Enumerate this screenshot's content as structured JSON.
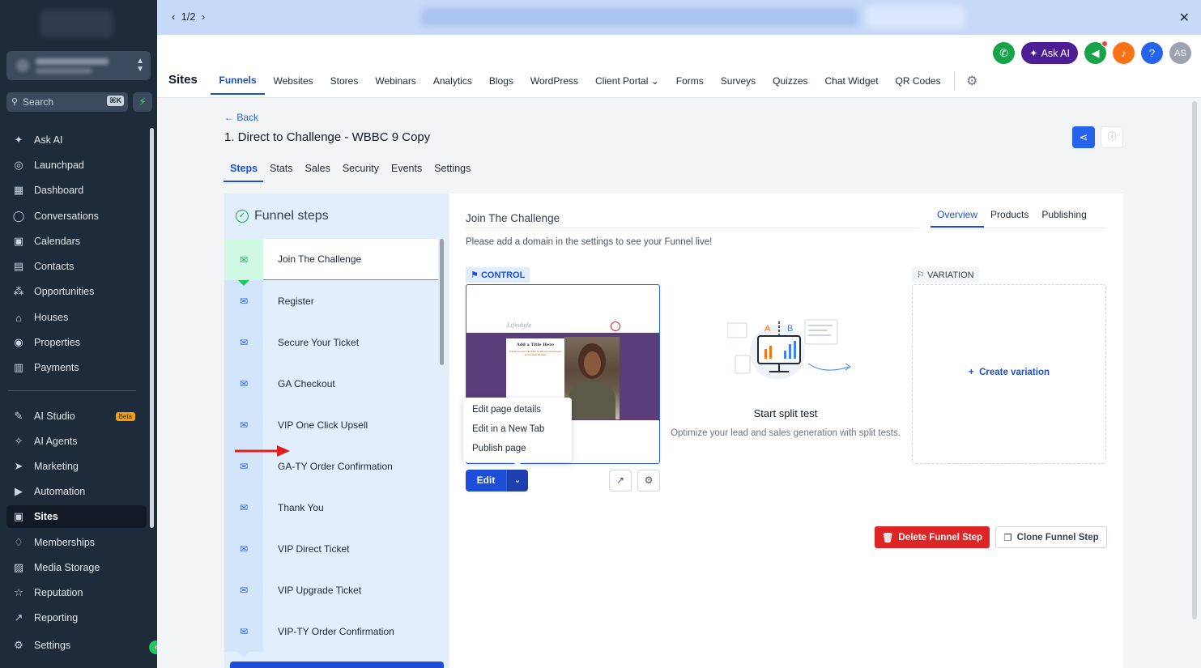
{
  "banner": {
    "pager": "1/2",
    "prev_icon": "chevron-left-icon",
    "next_icon": "chevron-right-icon",
    "close_icon": "close-icon"
  },
  "sidebar": {
    "search_placeholder": "Search",
    "search_shortcut": "⌘K",
    "items": [
      {
        "label": "Ask AI",
        "icon": "sparkle-icon"
      },
      {
        "label": "Launchpad",
        "icon": "rocket-icon"
      },
      {
        "label": "Dashboard",
        "icon": "grid-icon"
      },
      {
        "label": "Conversations",
        "icon": "chat-icon"
      },
      {
        "label": "Calendars",
        "icon": "calendar-icon"
      },
      {
        "label": "Contacts",
        "icon": "contacts-icon"
      },
      {
        "label": "Opportunities",
        "icon": "pipeline-icon"
      },
      {
        "label": "Houses",
        "icon": "house-icon"
      },
      {
        "label": "Properties",
        "icon": "search-circle-icon"
      },
      {
        "label": "Payments",
        "icon": "receipt-icon"
      },
      {
        "label": "AI Studio",
        "icon": "ai-studio-icon",
        "badge": "Beta"
      },
      {
        "label": "AI Agents",
        "icon": "sparkle-icon"
      },
      {
        "label": "Marketing",
        "icon": "send-icon"
      },
      {
        "label": "Automation",
        "icon": "play-circle-icon"
      },
      {
        "label": "Sites",
        "icon": "sites-icon"
      },
      {
        "label": "Memberships",
        "icon": "badge-icon"
      },
      {
        "label": "Media Storage",
        "icon": "image-icon"
      },
      {
        "label": "Reputation",
        "icon": "star-icon"
      },
      {
        "label": "Reporting",
        "icon": "chart-icon"
      }
    ],
    "settings_label": "Settings",
    "active_item": "Sites"
  },
  "header": {
    "ask_ai_label": "Ask AI",
    "avatar_initials": "AS",
    "help_label": "?",
    "section_title": "Sites",
    "nav": [
      "Funnels",
      "Websites",
      "Stores",
      "Webinars",
      "Analytics",
      "Blogs",
      "WordPress",
      "Client Portal",
      "Forms",
      "Surveys",
      "Quizzes",
      "Chat Widget",
      "QR Codes"
    ],
    "active_nav": "Funnels",
    "colors": {
      "phone": "#16a34a",
      "askai": "#4c1d95",
      "announce": "#16a34a",
      "bell": "#f97316",
      "help": "#2563eb",
      "avatar": "#9ca3af"
    }
  },
  "funnel": {
    "back_label": "← Back",
    "title": "1. Direct to Challenge - WBBC 9 Copy",
    "tabs": [
      "Steps",
      "Stats",
      "Sales",
      "Security",
      "Events",
      "Settings"
    ],
    "active_tab": "Steps"
  },
  "steps_panel": {
    "header": "Funnel steps",
    "steps": [
      "Join The Challenge",
      "Register",
      "Secure Your Ticket",
      "GA Checkout",
      "VIP One Click Upsell",
      "GA-TY Order Confirmation",
      "Thank You",
      "VIP Direct Ticket",
      "VIP Upgrade Ticket",
      "VIP-TY Order Confirmation"
    ],
    "active_step": "Join The Challenge"
  },
  "detail": {
    "step_name": "Join The Challenge",
    "tabs": [
      "Overview",
      "Products",
      "Publishing"
    ],
    "active_tab": "Overview",
    "domain_message": "Please add a domain in the settings to see your Funnel live!",
    "control_label": "CONTROL",
    "variation_label": "VARIATION",
    "preview": {
      "card_title": "Add a Title Here",
      "card_text": "Transform Your Life Path by Winning Investment and Growth Mindset"
    },
    "menu": [
      "Edit page details",
      "Edit in a New Tab",
      "Publish page"
    ],
    "edit_label": "Edit",
    "split_title": "Start split test",
    "split_subtitle": "Optimize your lead and sales generation with split tests.",
    "create_variation_label": "Create variation",
    "delete_label": "Delete Funnel Step",
    "clone_label": "Clone Funnel Step",
    "colors": {
      "accent": "#1d4ed8",
      "danger": "#dc2626",
      "annotation_arrow": "#e11d1d"
    }
  }
}
